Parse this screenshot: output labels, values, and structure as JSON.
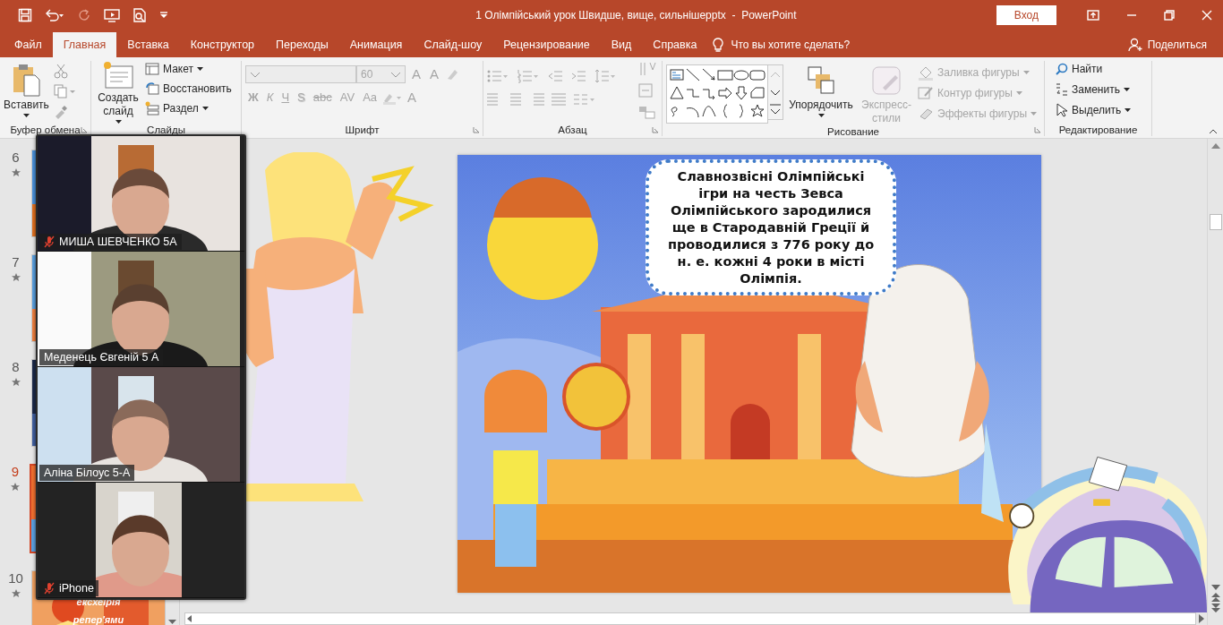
{
  "window": {
    "title": "1 Олімпійський урок Швидше, вище, сильнішеpptx  -  PowerPoint",
    "sign_in": "Вход"
  },
  "tabs": [
    {
      "label": "Файл",
      "selected": false
    },
    {
      "label": "Главная",
      "selected": true
    },
    {
      "label": "Вставка",
      "selected": false
    },
    {
      "label": "Конструктор",
      "selected": false
    },
    {
      "label": "Переходы",
      "selected": false
    },
    {
      "label": "Анимация",
      "selected": false
    },
    {
      "label": "Слайд-шоу",
      "selected": false
    },
    {
      "label": "Рецензирование",
      "selected": false
    },
    {
      "label": "Вид",
      "selected": false
    },
    {
      "label": "Справка",
      "selected": false
    }
  ],
  "tell_me": "Что вы хотите сделать?",
  "share": "Поделиться",
  "ribbon": {
    "clipboard": {
      "paste": "Вставить",
      "label": "Буфер обмена"
    },
    "slides": {
      "new_slide": "Создать слайд",
      "layout": "Макет",
      "reset": "Восстановить",
      "section": "Раздел",
      "label": "Слайды"
    },
    "font": {
      "disabled": true,
      "font_size": "60",
      "size_buttons": [
        "A",
        "A"
      ],
      "format_buttons": [
        "Ж",
        "К",
        "Ч",
        "S",
        "abc",
        "AV",
        "Aa"
      ],
      "color_button": "A",
      "label": "Шрифт"
    },
    "paragraph": {
      "label": "Абзац"
    },
    "drawing": {
      "arrange": "Упорядочить",
      "quick_styles": {
        "label": "Экспресс-стили",
        "disabled": true
      },
      "format_items": [
        {
          "label": "Заливка фигуры",
          "disabled": true
        },
        {
          "label": "Контур фигуры",
          "disabled": true
        },
        {
          "label": "Эффекты фигуры",
          "disabled": true
        }
      ],
      "label": "Рисование"
    },
    "editing": {
      "find": "Найти",
      "replace": "Заменить",
      "select": "Выделить",
      "label": "Редактирование"
    }
  },
  "thumbnails": [
    {
      "number": "6",
      "selected": false
    },
    {
      "number": "7",
      "selected": false
    },
    {
      "number": "8",
      "selected": false
    },
    {
      "number": "9",
      "selected": true
    },
    {
      "number": "10",
      "selected": false,
      "texts": [
        "ексхеірія",
        "репер'ями"
      ]
    }
  ],
  "slide": {
    "text": "Славнозвісні Олімпійські ігри на честь Зевса Олімпійського зародилися ще в Стародавній Греції й проводилися з 776 року до н. е. кожні 4 роки в  місті Олімпія."
  },
  "participants": [
    {
      "name": "МИША ШЕВЧЕНКО 5А",
      "muted": true
    },
    {
      "name": "Меденець Євгеній 5 А",
      "muted": false
    },
    {
      "name": "Аліна Білоус 5-А",
      "muted": false
    },
    {
      "name": "iPhone",
      "muted": true
    }
  ]
}
